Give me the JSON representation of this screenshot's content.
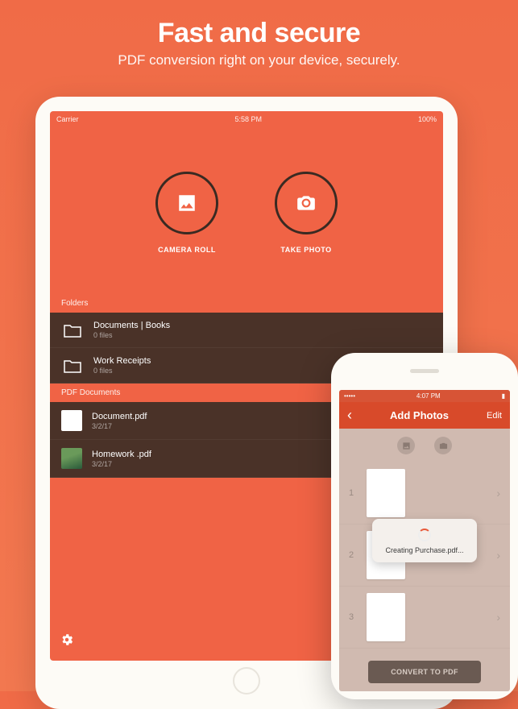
{
  "hero": {
    "title": "Fast and secure",
    "subtitle": "PDF conversion right on your device, securely."
  },
  "ipad": {
    "status": {
      "carrier": "Carrier",
      "time": "5:58 PM",
      "battery": "100%"
    },
    "sources": {
      "camera_roll": "CAMERA ROLL",
      "take_photo": "TAKE PHOTO"
    },
    "sections": {
      "folders_header": "Folders",
      "pdf_header": "PDF Documents"
    },
    "folders": [
      {
        "title": "Documents | Books",
        "sub": "0 files"
      },
      {
        "title": "Work Receipts",
        "sub": "0 files"
      }
    ],
    "pdfs": [
      {
        "title": "Document.pdf",
        "sub": "3/2/17"
      },
      {
        "title": "Homework .pdf",
        "sub": "3/2/17"
      }
    ]
  },
  "iphone": {
    "status_time": "4:07 PM",
    "nav": {
      "back": "‹",
      "title": "Add Photos",
      "edit": "Edit"
    },
    "rows": [
      {
        "n": "1"
      },
      {
        "n": "2"
      },
      {
        "n": "3"
      }
    ],
    "toast": "Creating Purchase.pdf...",
    "convert": "CONVERT TO PDF"
  }
}
